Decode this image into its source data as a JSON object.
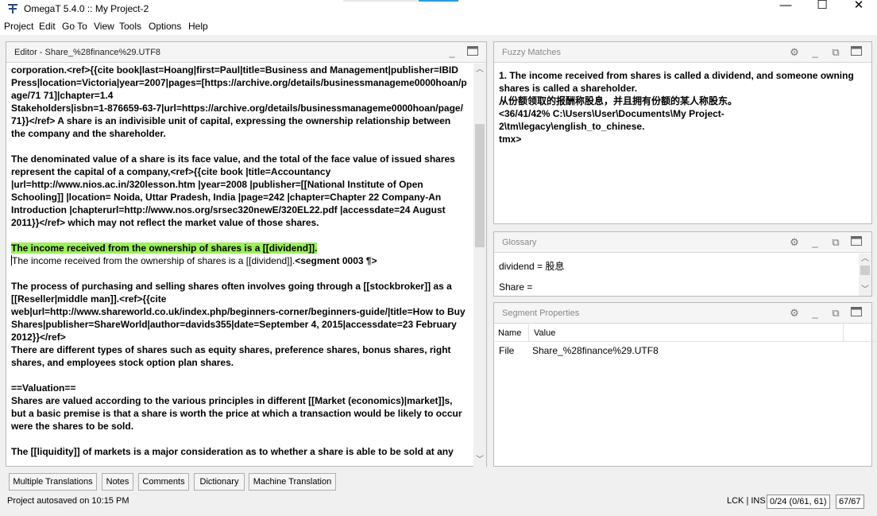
{
  "window": {
    "title": "OmegaT 5.4.0 :: My Project-2",
    "minimize": "—",
    "maximize": "☐",
    "close": "✕"
  },
  "menu": {
    "project": "Project",
    "edit": "Edit",
    "goto": "Go To",
    "view": "View",
    "tools": "Tools",
    "options": "Options",
    "help": "Help"
  },
  "editor": {
    "title": "Editor - Share_%28finance%29.UTF8",
    "lines": [
      "corporation.<ref>{{cite book|last=Hoang|first=Paul|title=Business and Management|publisher=IBID",
      "Press|location=Victoria|year=2007|pages=[https://archive.org/details/businessmanageme0000hoan/p",
      "age/71 71]|chapter=1.4",
      "Stakeholders|isbn=1-876659-63-7|url=https://archive.org/details/businessmanageme0000hoan/page/",
      "71}}</ref>  A share is an indivisible unit of capital, expressing the ownership relationship between",
      "the company and the shareholder.",
      "",
      "The denominated value of a share is its face value, and the total of the face value of issued shares",
      "represent the capital of a company,<ref>{{cite book |title=Accountancy",
      "|url=http://www.nios.ac.in/320lesson.htm |year=2008 |publisher=[[National Institute of Open",
      "Schooling]] |location= Noida, Uttar Pradesh, India |page=242 |chapter=Chapter 22 Company-An",
      "Introduction |chapterurl=http://www.nos.org/srsec320newE/320EL22.pdf |accessdate=24 August",
      "2011}}</ref> which may not reflect the market value of those shares.",
      ""
    ],
    "active_source": "The income received from the ownership of shares is a [[dividend]].",
    "active_target": "The income received from the ownership of shares is a [[dividend]].",
    "segment_marker": "<segment 0003 ¶>",
    "lines_after": [
      "",
      "The process of purchasing and selling shares often involves going through a [[stockbroker]] as a",
      "[[Reseller|middle man]].<ref>{{cite",
      "web|url=http://www.shareworld.co.uk/index.php/beginners-corner/beginners-guide/|title=How to Buy",
      "Shares|publisher=ShareWorld|author=davids355|date=September 4, 2015|accessdate=23 February",
      "2012}}</ref>",
      "There are different types of shares such as equity shares, preference shares, bonus shares, right",
      "shares, and employees stock option plan shares.",
      "",
      "==Valuation==",
      "Shares are valued according to the various principles in different [[Market (economics)|market]]s,",
      "but a basic premise is that a share is worth the price at which a transaction would be likely to occur",
      "were the shares to be sold.",
      "",
      "The [[liquidity]] of markets is a major consideration as to whether a share is able to be sold at any"
    ]
  },
  "fuzzy": {
    "title": "Fuzzy Matches",
    "match_line1": "1. The income received from shares is called a dividend, and someone owning",
    "match_line2": "shares is called a shareholder.",
    "match_target": "从份额领取的报酬称股息，并且拥有份额的某人称股东。",
    "match_info1": "<36/41/42% C:\\Users\\User\\Documents\\My Project-2\\tm\\legacy\\english_to_chinese.",
    "match_info2": "tmx>"
  },
  "glossary": {
    "title": "Glossary",
    "entry1": "dividend = 股息",
    "entry2": "Share ="
  },
  "segprops": {
    "title": "Segment Properties",
    "col_name": "Name",
    "col_value": "Value",
    "row_name": "File",
    "row_value": "Share_%28finance%29.UTF8"
  },
  "tabs": [
    "Multiple Translations",
    "Notes",
    "Comments",
    "Dictionary",
    "Machine Translation"
  ],
  "status": {
    "message": "Project autosaved on 10:15 PM",
    "mode": "LCK | INS",
    "progress": "0/24 (0/61, 61)",
    "count": "67/67"
  },
  "colors": {
    "active_source_bg": "#9cf05a",
    "accent": "#2a9bd8"
  }
}
